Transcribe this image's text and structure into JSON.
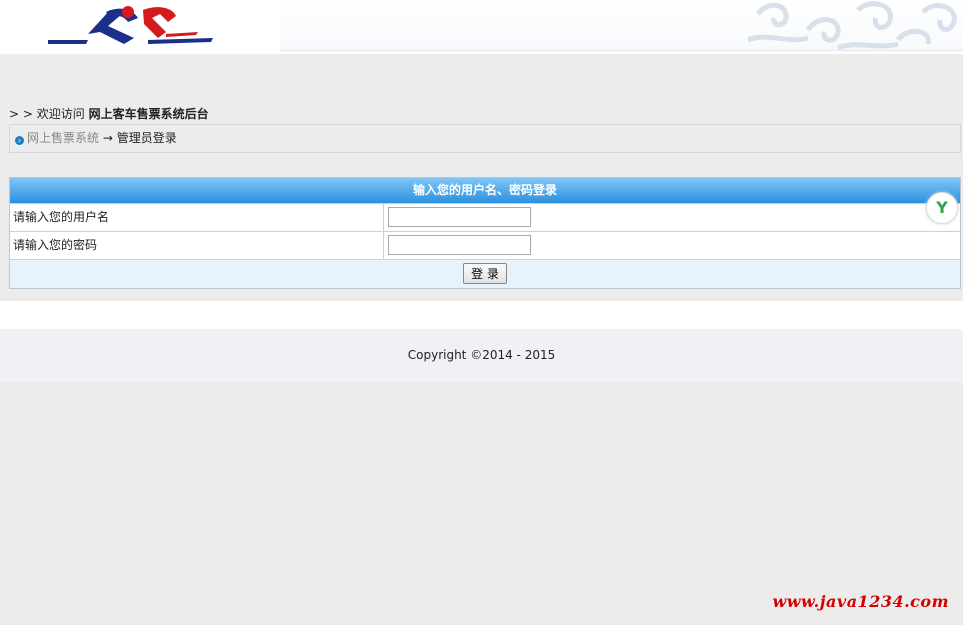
{
  "welcome": {
    "prefix": "> > 欢迎访问 ",
    "site_name": "网上客车售票系统后台"
  },
  "breadcrumb": {
    "home": "网上售票系统",
    "arrow": "→",
    "current": "管理员登录"
  },
  "login": {
    "title": "输入您的用户名、密码登录",
    "username_label": "请输入您的用户名",
    "password_label": "请输入您的密码",
    "username_value": "",
    "password_value": "",
    "submit_label": "登 录"
  },
  "footer": {
    "copyright": "Copyright ©2014 - 2015"
  },
  "watermark": "www.java1234.com",
  "colors": {
    "title_bar": "#2a90e0",
    "watermark": "#d40000",
    "button_row": "#e6f3fd"
  },
  "icons": {
    "side_widget": "y-logo-icon",
    "breadcrumb_bullet": "arrow-circle-icon"
  }
}
